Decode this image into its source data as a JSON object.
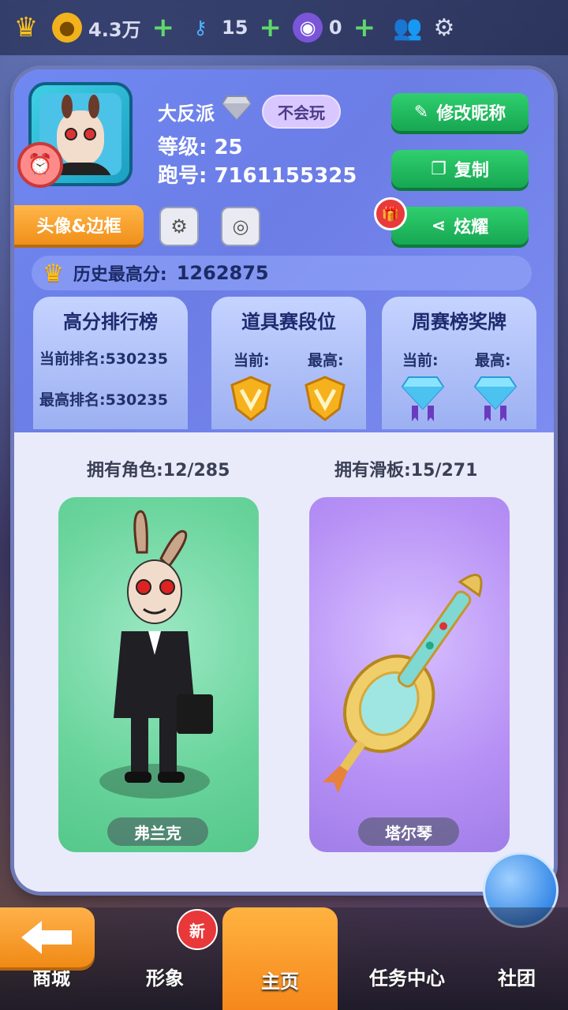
{
  "topbar": {
    "coins": "4.3万",
    "keys": "15",
    "tokens": "0"
  },
  "profile": {
    "name": "大反派",
    "tag": "不会玩",
    "level_label": "等级:",
    "level": "25",
    "run_id_label": "跑号:",
    "run_id": "7161155325",
    "avatar_frame_button": "头像&边框",
    "edit_name_button": "修改昵称",
    "copy_button": "复制",
    "share_button": "炫耀"
  },
  "high_score": {
    "label": "历史最高分:",
    "value": "1262875"
  },
  "cards": {
    "leaderboard": {
      "title": "高分排行榜",
      "current_rank": "当前排名:530235",
      "best_rank": "最高排名:530235"
    },
    "item_tier": {
      "title": "道具赛段位",
      "current": "当前:",
      "highest": "最高:"
    },
    "weekly": {
      "title": "周赛榜奖牌",
      "current": "当前:",
      "highest": "最高:"
    }
  },
  "collection": {
    "characters_owned": "拥有角色:12/285",
    "boards_owned": "拥有滑板:15/271",
    "character_name": "弗兰克",
    "board_name": "塔尔琴"
  },
  "nav": {
    "shop": "商城",
    "outfit": "形象",
    "home": "主页",
    "tasks": "任务中心",
    "club": "社团",
    "new_badge": "新"
  },
  "colors": {
    "accent_green": "#1fb85f",
    "accent_orange": "#f59a22",
    "panel_blue": "#6f88f2"
  }
}
